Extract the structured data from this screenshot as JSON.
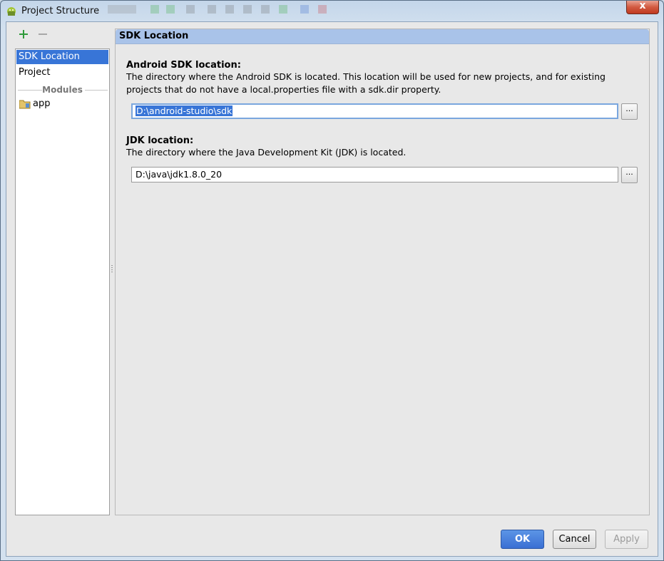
{
  "window": {
    "title": "Project Structure",
    "close_label": "x"
  },
  "toolbar": {
    "add_icon": "plus-icon",
    "remove_icon": "minus-icon"
  },
  "sidebar": {
    "items": [
      {
        "label": "SDK Location",
        "selected": true
      },
      {
        "label": "Project",
        "selected": false
      }
    ],
    "modules_header": "Modules",
    "modules": [
      {
        "label": "app",
        "icon": "module-folder-icon"
      }
    ]
  },
  "panel": {
    "header": "SDK Location",
    "android_sdk": {
      "title": "Android SDK location:",
      "description": "The directory where the Android SDK is located. This location will be used for new projects, and for existing projects that do not have a local.properties file with a sdk.dir property.",
      "value": "D:\\android-studio\\sdk",
      "browse_label": "..."
    },
    "jdk": {
      "title": "JDK location:",
      "description": "The directory where the Java Development Kit (JDK) is located.",
      "value": "D:\\java\\jdk1.8.0_20",
      "browse_label": "..."
    }
  },
  "buttons": {
    "ok": "OK",
    "cancel": "Cancel",
    "apply": "Apply"
  },
  "colors": {
    "selection": "#3875d7",
    "header_bg": "#a9c3e9",
    "ok_button": "#3a6fd3",
    "add_icon": "#2e9a3a"
  }
}
